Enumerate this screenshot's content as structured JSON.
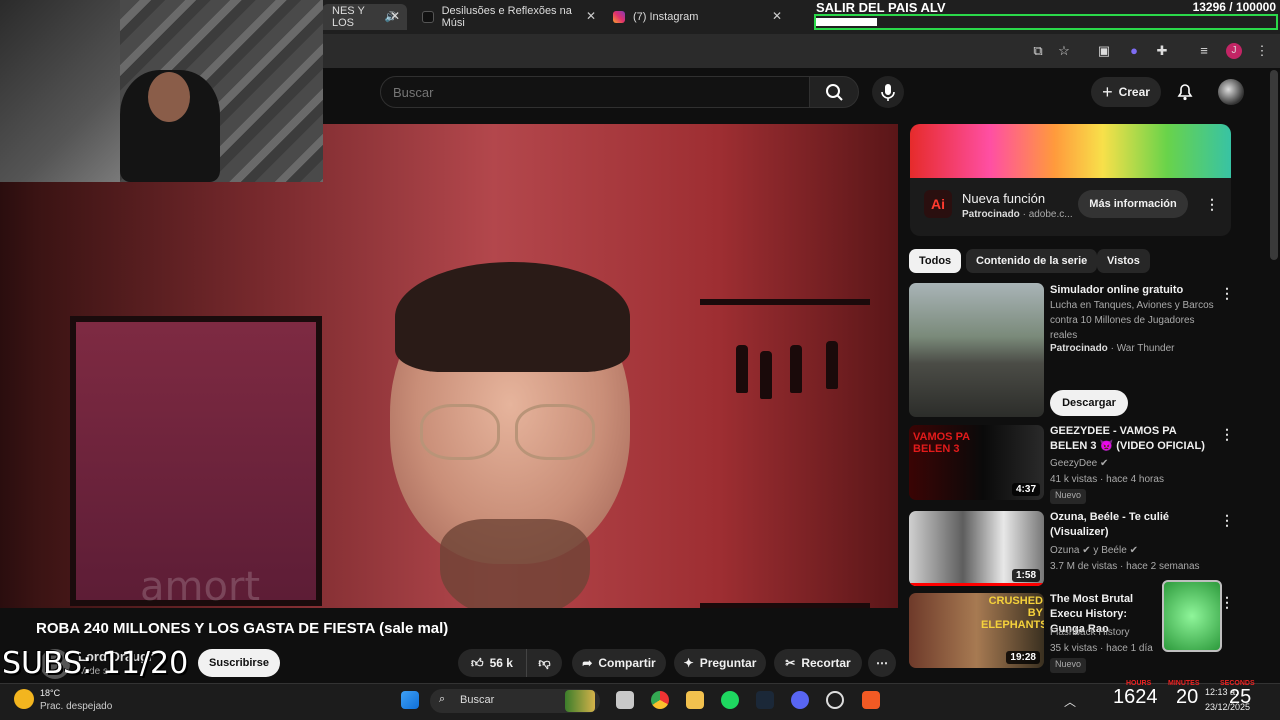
{
  "tabs": [
    {
      "label": "NES Y LOS"
    },
    {
      "label": "Desilusões e Reflexões na Músi"
    },
    {
      "label": "(7) Instagram"
    }
  ],
  "overlay": {
    "goal_title": "SALIR DEL PAIS ALV",
    "goal_count": "13296 / 100000",
    "goal_fraction": 0.133,
    "subs_counter": "SUBS: 11/20"
  },
  "search": {
    "placeholder": "Buscar"
  },
  "header": {
    "create_label": "Crear"
  },
  "video": {
    "title": "ROBA 240 MILLONES Y LOS GASTA DE FIESTA (sale mal)",
    "watermark": "amort",
    "channel": "Lord Draugr",
    "channel_subs": "M de s",
    "subscribe_label": "Suscribirse",
    "likes": "56 k",
    "share_label": "Compartir",
    "ask_label": "Preguntar",
    "clip_label": "Recortar"
  },
  "ad": {
    "logo_text": "Ai",
    "title": "Nueva función",
    "sponsored": "Patrocinado",
    "domain": "adobe.c...",
    "cta": "Más información"
  },
  "chips": [
    "Todos",
    "Contenido de la serie",
    "Vistos"
  ],
  "sidebar_items": [
    {
      "title": "Simulador online gratuito",
      "desc": "Lucha en Tanques, Aviones y Barcos contra 10 Millones de Jugadores reales",
      "sponsored": "Patrocinado",
      "advertiser": "War Thunder",
      "cta": "Descargar"
    },
    {
      "title": "GEEZYDEE - VAMOS PA BELEN 3 👿 (VIDEO OFICIAL)",
      "channel": "GeezyDee",
      "meta": "41 k vistas · hace 4 horas",
      "badge": "Nuevo",
      "duration": "4:37",
      "thumb_text": "VAMOS PA BELEN 3"
    },
    {
      "title": "Ozuna, Beéle - Te culié (Visualizer)",
      "channel": "Ozuna",
      "channel_extra": "y Beéle",
      "meta": "3.7 M de vistas · hace 2 semanas",
      "duration": "1:58"
    },
    {
      "title": "The Most Brutal Execu History: Gunga Rao",
      "channel": "Flashback History",
      "meta": "35 k vistas · hace 1 día",
      "badge": "Nuevo",
      "duration": "19:28",
      "thumb_text": "CRUSHED BY ELEPHANTS"
    }
  ],
  "taskbar": {
    "temp": "18°C",
    "weather": "Prac. despejado",
    "search": "Buscar",
    "time": "12:13 a.",
    "date": "23/12/2025"
  },
  "stream_timer": {
    "hours": "1624",
    "minutes": "20",
    "seconds": "25",
    "h_label": "HOURS",
    "m_label": "MINUTES",
    "s_label": "SECONDS"
  },
  "colors": {
    "goal_bar": "#2bd94a",
    "accent_red": "#ff0000"
  }
}
